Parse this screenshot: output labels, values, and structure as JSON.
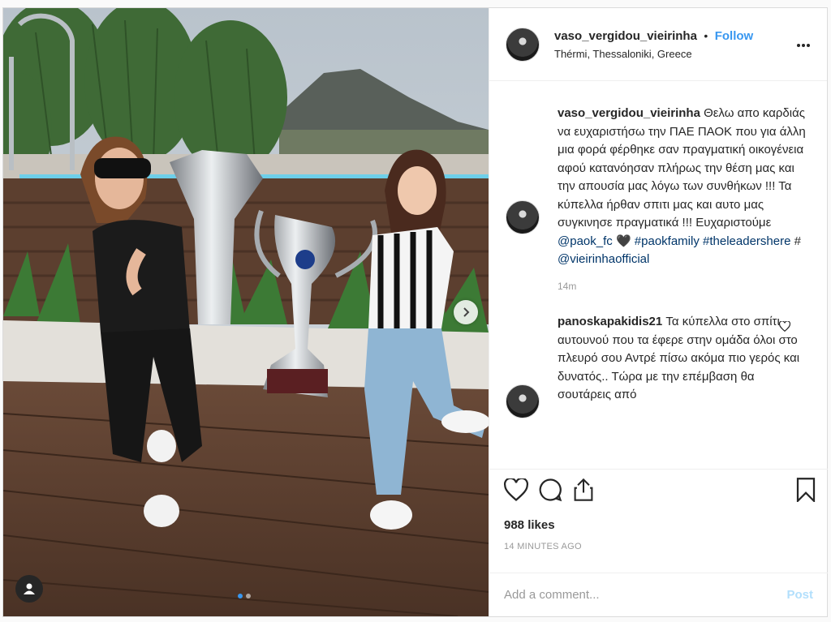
{
  "post": {
    "username": "vaso_vergidou_vieirinha",
    "bullet": "•",
    "follow_label": "Follow",
    "location": "Thérmi, Thessaloniki, Greece",
    "more_icon": "more-horizontal-icon"
  },
  "photo": {
    "carousel_dots": 2,
    "active_dot": 0,
    "next_icon": "chevron-right-icon",
    "user_tag_icon": "user-icon"
  },
  "caption": {
    "author": "vaso_vergidou_vieirinha",
    "text": "Θελω απο καρδιάς να ευχαριστήσω την ΠΑΕ ΠΑΟΚ που για άλλη μια φορά φέρθηκε σαν πραγματική οικογένεια αφού κατανόησαν πλήρως την θέση μας και την απουσία μας λόγω των συνθήκων !!! Τα κύπελλα ήρθαν σπιτι μας και αυτο μας συγκινησε πραγματικά !!! Ευχαριστούμε",
    "mention": "@paok_fc",
    "heart": "🖤",
    "tag1": "#paokfamily",
    "tag2": "#theleadershere",
    "tag3": "#",
    "mention2": "@vieirinhaofficial",
    "time": "14m"
  },
  "comments": [
    {
      "author": "panoskapakidis21",
      "text": "Τα κύπελλα στο σπίτι αυτουνού που τα έφερε στην ομάδα όλοι στο πλευρό σου Αντρέ πίσω ακόμα πιο γερός και δυνατός.. Τώρα με την επέμβαση θα σουτάρεις από"
    }
  ],
  "actions": {
    "like_icon": "heart-icon",
    "comment_icon": "comment-icon",
    "share_icon": "share-icon",
    "save_icon": "bookmark-icon",
    "likes": "988 likes",
    "time_ago": "14 MINUTES AGO"
  },
  "add_comment": {
    "placeholder": "Add a comment...",
    "post_label": "Post"
  }
}
